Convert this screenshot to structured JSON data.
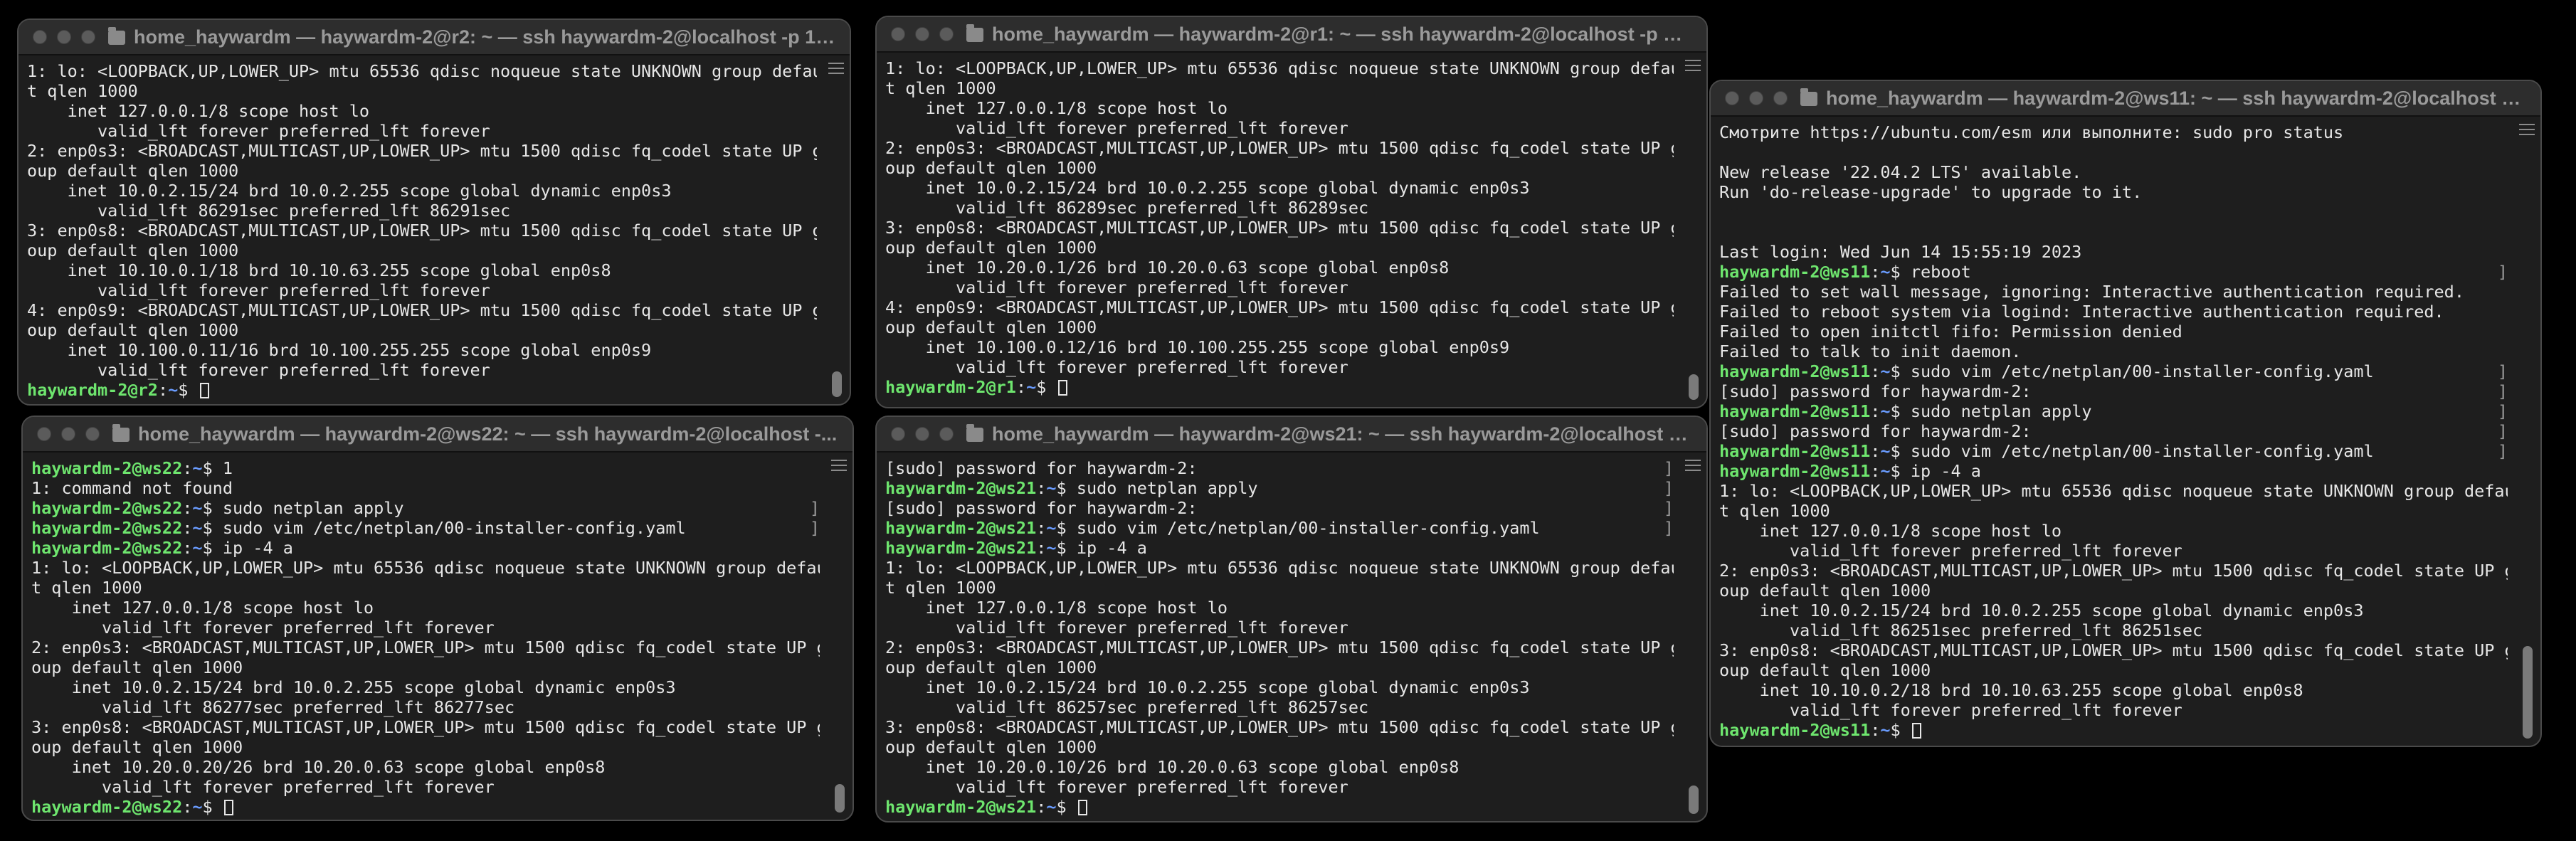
{
  "windows": [
    {
      "id": "r2",
      "title": "home_haywardm — haywardm-2@r2: ~ — ssh haywardm-2@localhost -p 12...",
      "lines": [
        {
          "t": "1: lo: <LOOPBACK,UP,LOWER_UP> mtu 65536 qdisc noqueue state UNKNOWN group defaul"
        },
        {
          "t": "t qlen 1000"
        },
        {
          "t": "    inet 127.0.0.1/8 scope host lo"
        },
        {
          "t": "       valid_lft forever preferred_lft forever"
        },
        {
          "t": "2: enp0s3: <BROADCAST,MULTICAST,UP,LOWER_UP> mtu 1500 qdisc fq_codel state UP gr"
        },
        {
          "t": "oup default qlen 1000"
        },
        {
          "t": "    inet 10.0.2.15/24 brd 10.0.2.255 scope global dynamic enp0s3"
        },
        {
          "t": "       valid_lft 86291sec preferred_lft 86291sec"
        },
        {
          "t": "3: enp0s8: <BROADCAST,MULTICAST,UP,LOWER_UP> mtu 1500 qdisc fq_codel state UP gr"
        },
        {
          "t": "oup default qlen 1000"
        },
        {
          "t": "    inet 10.10.0.1/18 brd 10.10.63.255 scope global enp0s8"
        },
        {
          "t": "       valid_lft forever preferred_lft forever"
        },
        {
          "t": "4: enp0s9: <BROADCAST,MULTICAST,UP,LOWER_UP> mtu 1500 qdisc fq_codel state UP gr"
        },
        {
          "t": "oup default qlen 1000"
        },
        {
          "t": "    inet 10.100.0.11/16 brd 10.100.255.255 scope global enp0s9"
        },
        {
          "t": "       valid_lft forever preferred_lft forever"
        },
        {
          "p": "haywardm-2@r2",
          "path": "~",
          "t": "",
          "cursor": true
        }
      ]
    },
    {
      "id": "r1",
      "title": "home_haywardm — haywardm-2@r1: ~ — ssh haywardm-2@localhost -p 45...",
      "lines": [
        {
          "t": "1: lo: <LOOPBACK,UP,LOWER_UP> mtu 65536 qdisc noqueue state UNKNOWN group defaul"
        },
        {
          "t": "t qlen 1000"
        },
        {
          "t": "    inet 127.0.0.1/8 scope host lo"
        },
        {
          "t": "       valid_lft forever preferred_lft forever"
        },
        {
          "t": "2: enp0s3: <BROADCAST,MULTICAST,UP,LOWER_UP> mtu 1500 qdisc fq_codel state UP gr"
        },
        {
          "t": "oup default qlen 1000"
        },
        {
          "t": "    inet 10.0.2.15/24 brd 10.0.2.255 scope global dynamic enp0s3"
        },
        {
          "t": "       valid_lft 86289sec preferred_lft 86289sec"
        },
        {
          "t": "3: enp0s8: <BROADCAST,MULTICAST,UP,LOWER_UP> mtu 1500 qdisc fq_codel state UP gr"
        },
        {
          "t": "oup default qlen 1000"
        },
        {
          "t": "    inet 10.20.0.1/26 brd 10.20.0.63 scope global enp0s8"
        },
        {
          "t": "       valid_lft forever preferred_lft forever"
        },
        {
          "t": "4: enp0s9: <BROADCAST,MULTICAST,UP,LOWER_UP> mtu 1500 qdisc fq_codel state UP gr"
        },
        {
          "t": "oup default qlen 1000"
        },
        {
          "t": "    inet 10.100.0.12/16 brd 10.100.255.255 scope global enp0s9"
        },
        {
          "t": "       valid_lft forever preferred_lft forever"
        },
        {
          "p": "haywardm-2@r1",
          "path": "~",
          "t": "",
          "cursor": true
        }
      ]
    },
    {
      "id": "ws11",
      "title": "home_haywardm — haywardm-2@ws11: ~ — ssh haywardm-2@localhost -p...",
      "lines": [
        {
          "t": "Смотрите https://ubuntu.com/esm или выполните: sudo pro status"
        },
        {
          "t": ""
        },
        {
          "t": "New release '22.04.2 LTS' available."
        },
        {
          "t": "Run 'do-release-upgrade' to upgrade to it."
        },
        {
          "t": ""
        },
        {
          "t": ""
        },
        {
          "t": "Last login: Wed Jun 14 15:55:19 2023"
        },
        {
          "p": "haywardm-2@ws11",
          "path": "~",
          "t": " reboot",
          "bracket": "]"
        },
        {
          "t": "Failed to set wall message, ignoring: Interactive authentication required."
        },
        {
          "t": "Failed to reboot system via logind: Interactive authentication required."
        },
        {
          "t": "Failed to open initctl fifo: Permission denied"
        },
        {
          "t": "Failed to talk to init daemon."
        },
        {
          "p": "haywardm-2@ws11",
          "path": "~",
          "t": " sudo vim /etc/netplan/00-installer-config.yaml",
          "bracket": "]"
        },
        {
          "t": "[sudo] password for haywardm-2:",
          "bracket": "]"
        },
        {
          "p": "haywardm-2@ws11",
          "path": "~",
          "t": " sudo netplan apply",
          "bracket": "]"
        },
        {
          "t": "[sudo] password for haywardm-2:",
          "bracket": "]"
        },
        {
          "p": "haywardm-2@ws11",
          "path": "~",
          "t": " sudo vim /etc/netplan/00-installer-config.yaml",
          "bracket": "]"
        },
        {
          "p": "haywardm-2@ws11",
          "path": "~",
          "t": " ip -4 a"
        },
        {
          "t": "1: lo: <LOOPBACK,UP,LOWER_UP> mtu 65536 qdisc noqueue state UNKNOWN group defaul"
        },
        {
          "t": "t qlen 1000"
        },
        {
          "t": "    inet 127.0.0.1/8 scope host lo"
        },
        {
          "t": "       valid_lft forever preferred_lft forever"
        },
        {
          "t": "2: enp0s3: <BROADCAST,MULTICAST,UP,LOWER_UP> mtu 1500 qdisc fq_codel state UP gr"
        },
        {
          "t": "oup default qlen 1000"
        },
        {
          "t": "    inet 10.0.2.15/24 brd 10.0.2.255 scope global dynamic enp0s3"
        },
        {
          "t": "       valid_lft 86251sec preferred_lft 86251sec"
        },
        {
          "t": "3: enp0s8: <BROADCAST,MULTICAST,UP,LOWER_UP> mtu 1500 qdisc fq_codel state UP gr"
        },
        {
          "t": "oup default qlen 1000"
        },
        {
          "t": "    inet 10.10.0.2/18 brd 10.10.63.255 scope global enp0s8"
        },
        {
          "t": "       valid_lft forever preferred_lft forever"
        },
        {
          "p": "haywardm-2@ws11",
          "path": "~",
          "t": "",
          "cursor": true
        }
      ]
    },
    {
      "id": "ws22",
      "title": "home_haywardm — haywardm-2@ws22: ~ — ssh haywardm-2@localhost -...",
      "lines": [
        {
          "p": "haywardm-2@ws22",
          "path": "~",
          "t": " 1"
        },
        {
          "t": "1: command not found"
        },
        {
          "p": "haywardm-2@ws22",
          "path": "~",
          "t": " sudo netplan apply",
          "bracket": "]"
        },
        {
          "p": "haywardm-2@ws22",
          "path": "~",
          "t": " sudo vim /etc/netplan/00-installer-config.yaml",
          "bracket": "]"
        },
        {
          "p": "haywardm-2@ws22",
          "path": "~",
          "t": " ip -4 a"
        },
        {
          "t": "1: lo: <LOOPBACK,UP,LOWER_UP> mtu 65536 qdisc noqueue state UNKNOWN group defaul"
        },
        {
          "t": "t qlen 1000"
        },
        {
          "t": "    inet 127.0.0.1/8 scope host lo"
        },
        {
          "t": "       valid_lft forever preferred_lft forever"
        },
        {
          "t": "2: enp0s3: <BROADCAST,MULTICAST,UP,LOWER_UP> mtu 1500 qdisc fq_codel state UP gr"
        },
        {
          "t": "oup default qlen 1000"
        },
        {
          "t": "    inet 10.0.2.15/24 brd 10.0.2.255 scope global dynamic enp0s3"
        },
        {
          "t": "       valid_lft 86277sec preferred_lft 86277sec"
        },
        {
          "t": "3: enp0s8: <BROADCAST,MULTICAST,UP,LOWER_UP> mtu 1500 qdisc fq_codel state UP gr"
        },
        {
          "t": "oup default qlen 1000"
        },
        {
          "t": "    inet 10.20.0.20/26 brd 10.20.0.63 scope global enp0s8"
        },
        {
          "t": "       valid_lft forever preferred_lft forever"
        },
        {
          "p": "haywardm-2@ws22",
          "path": "~",
          "t": "",
          "cursor": true
        }
      ]
    },
    {
      "id": "ws21",
      "title": "home_haywardm — haywardm-2@ws21: ~ — ssh haywardm-2@localhost -p...",
      "lines": [
        {
          "t": "[sudo] password for haywardm-2:",
          "bracket": "]"
        },
        {
          "p": "haywardm-2@ws21",
          "path": "~",
          "t": " sudo netplan apply",
          "bracket": "]"
        },
        {
          "t": "[sudo] password for haywardm-2:",
          "bracket": "]"
        },
        {
          "p": "haywardm-2@ws21",
          "path": "~",
          "t": " sudo vim /etc/netplan/00-installer-config.yaml",
          "bracket": "]"
        },
        {
          "p": "haywardm-2@ws21",
          "path": "~",
          "t": " ip -4 a"
        },
        {
          "t": "1: lo: <LOOPBACK,UP,LOWER_UP> mtu 65536 qdisc noqueue state UNKNOWN group defaul"
        },
        {
          "t": "t qlen 1000"
        },
        {
          "t": "    inet 127.0.0.1/8 scope host lo"
        },
        {
          "t": "       valid_lft forever preferred_lft forever"
        },
        {
          "t": "2: enp0s3: <BROADCAST,MULTICAST,UP,LOWER_UP> mtu 1500 qdisc fq_codel state UP gr"
        },
        {
          "t": "oup default qlen 1000"
        },
        {
          "t": "    inet 10.0.2.15/24 brd 10.0.2.255 scope global dynamic enp0s3"
        },
        {
          "t": "       valid_lft 86257sec preferred_lft 86257sec"
        },
        {
          "t": "3: enp0s8: <BROADCAST,MULTICAST,UP,LOWER_UP> mtu 1500 qdisc fq_codel state UP gr"
        },
        {
          "t": "oup default qlen 1000"
        },
        {
          "t": "    inet 10.20.0.10/26 brd 10.20.0.63 scope global enp0s8"
        },
        {
          "t": "       valid_lft forever preferred_lft forever"
        },
        {
          "p": "haywardm-2@ws21",
          "path": "~",
          "t": "",
          "cursor": true
        }
      ]
    }
  ],
  "prompt_suffix": ":",
  "prompt_dollar": "$"
}
